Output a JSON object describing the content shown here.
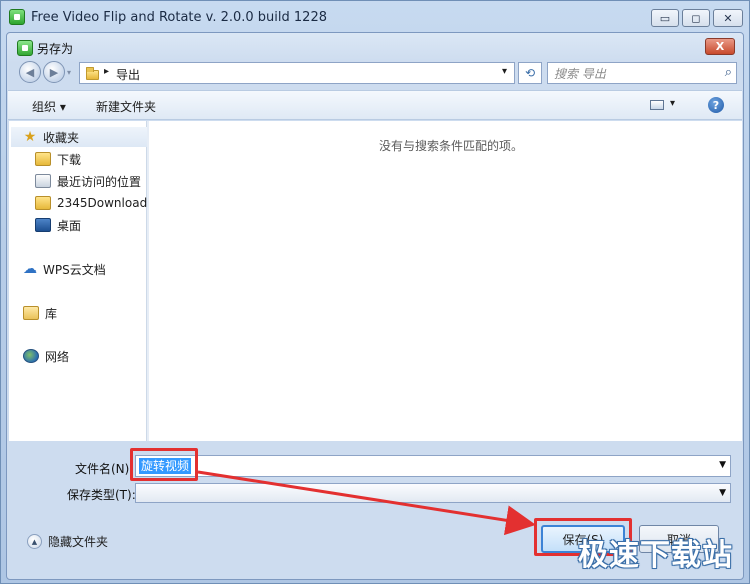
{
  "app": {
    "title": "Free Video Flip and Rotate  v. 2.0.0 build 1228",
    "minimize_label": "▭",
    "maximize_label": "◻",
    "close_label": "✕"
  },
  "dialog": {
    "title": "另存为",
    "close_label": "X"
  },
  "address": {
    "path_arrow": "▸",
    "current_folder": "导出",
    "dropdown_arrow": "▾"
  },
  "search": {
    "placeholder": "搜索 导出"
  },
  "toolbar": {
    "organize_label": "组织 ▾",
    "new_folder_label": "新建文件夹",
    "view_arrow": "▾"
  },
  "sidebar": {
    "favorites_label": "收藏夹",
    "items": [
      {
        "label": "下载",
        "icon": "download-folder-icon"
      },
      {
        "label": "最近访问的位置",
        "icon": "recent-places-icon"
      },
      {
        "label": "2345Download",
        "icon": "folder-icon"
      },
      {
        "label": "桌面",
        "icon": "desktop-icon"
      }
    ],
    "wps_label": "WPS云文档",
    "library_label": "库",
    "network_label": "网络"
  },
  "content": {
    "empty_message": "没有与搜索条件匹配的项。"
  },
  "form": {
    "filename_label": "文件名(N):",
    "filename_value": "旋转视频",
    "filetype_label": "保存类型(T):",
    "filetype_value": ""
  },
  "footer": {
    "hide_folders_label": "隐藏文件夹",
    "save_label": "保存(S)",
    "cancel_label": "取消"
  },
  "watermark": {
    "text": "极速下载站"
  },
  "colors": {
    "annotation_red": "#e33030",
    "selection_blue": "#3399ff"
  }
}
